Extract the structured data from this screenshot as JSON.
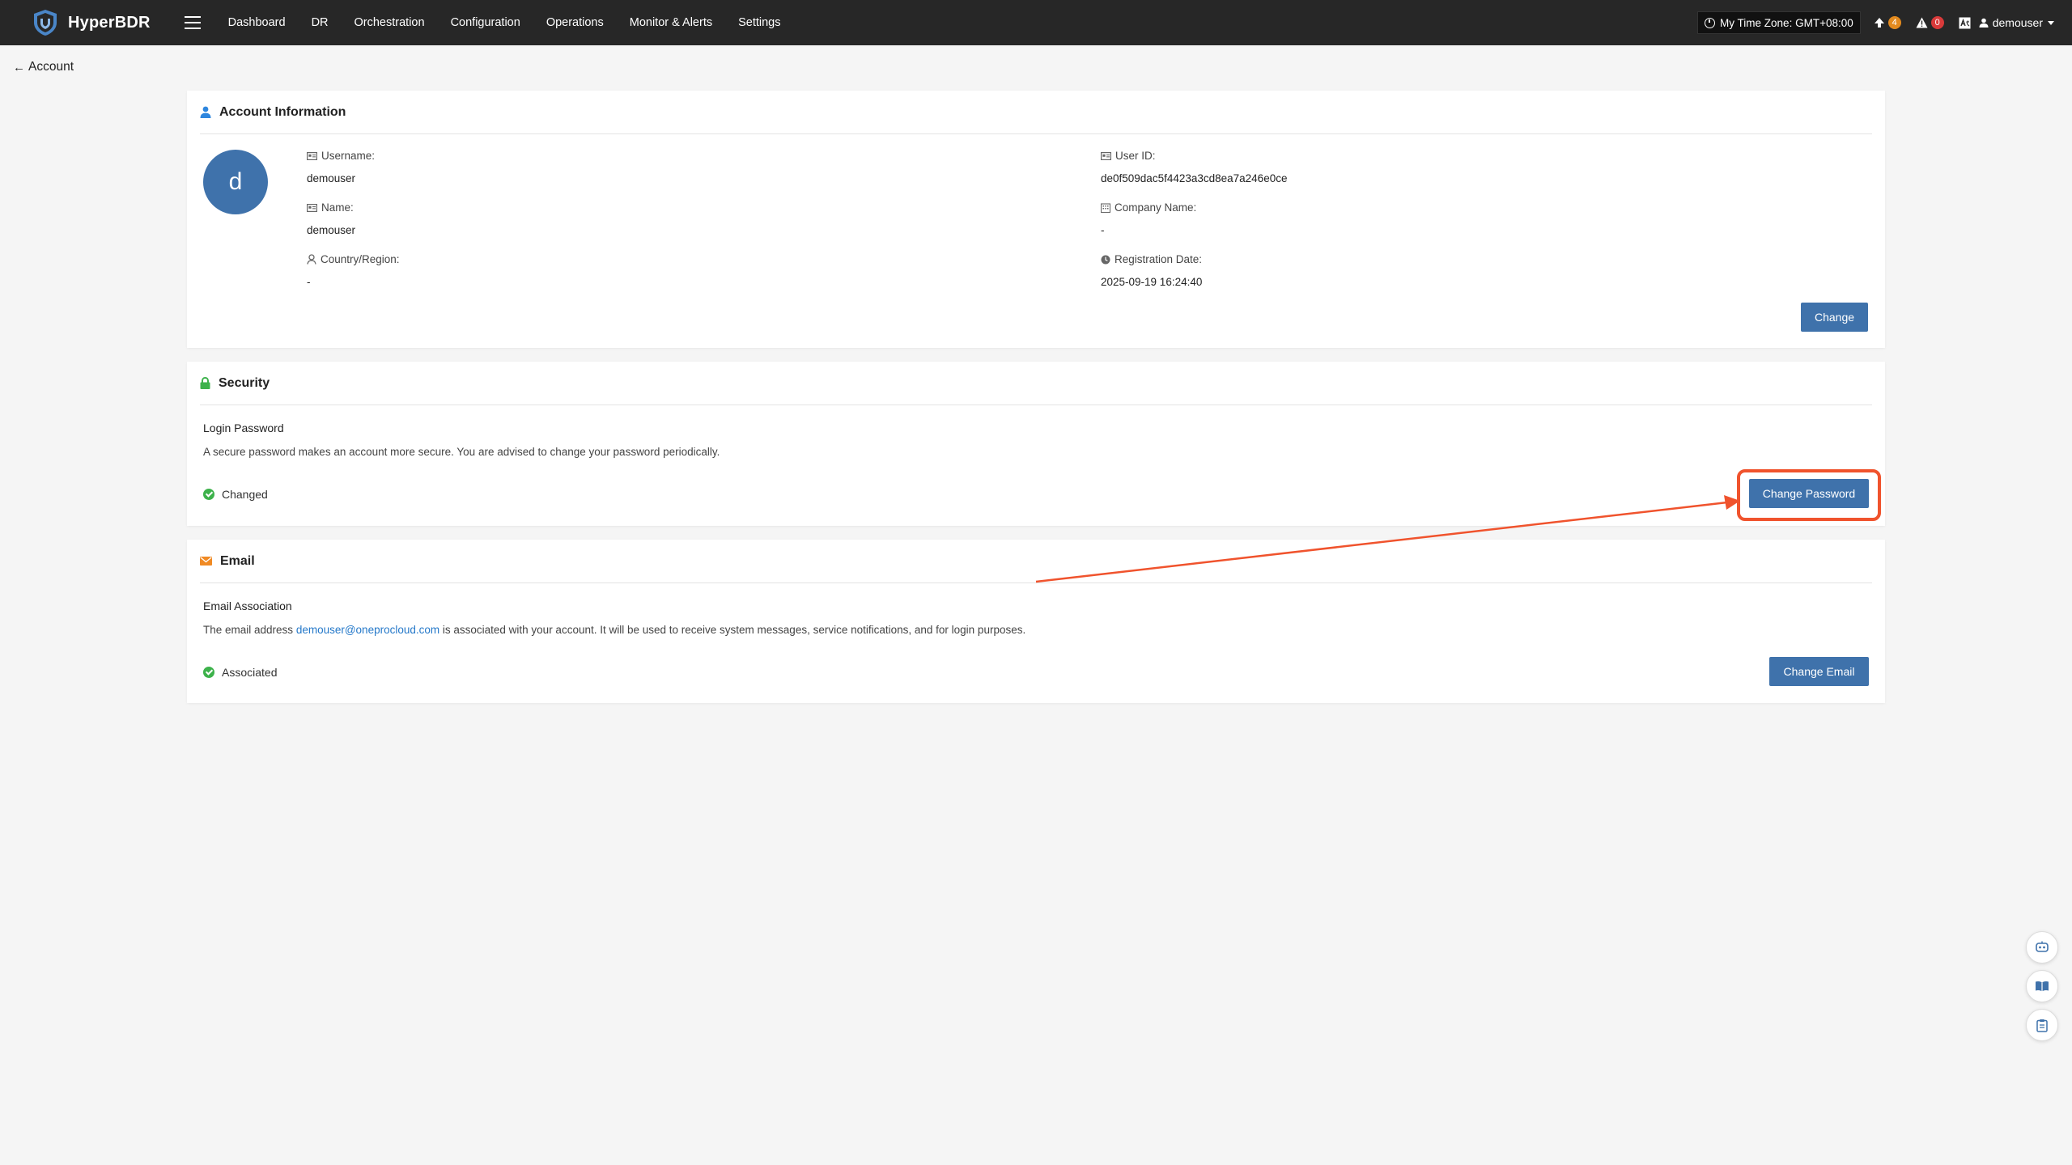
{
  "app": {
    "name": "HyperBDR"
  },
  "nav": [
    "Dashboard",
    "DR",
    "Orchestration",
    "Configuration",
    "Operations",
    "Monitor & Alerts",
    "Settings"
  ],
  "topbar": {
    "timezone": "My Time Zone: GMT+08:00",
    "upgrade_count": "4",
    "alert_count": "0",
    "username": "demouser"
  },
  "back_label": "Account",
  "account": {
    "title": "Account Information",
    "avatar_letter": "d",
    "fields": {
      "username_label": "Username:",
      "username": "demouser",
      "name_label": "Name:",
      "name": "demouser",
      "country_label": "Country/Region:",
      "country": "-",
      "userid_label": "User ID:",
      "userid": "de0f509dac5f4423a3cd8ea7a246e0ce",
      "company_label": "Company Name:",
      "company": "-",
      "regdate_label": "Registration Date:",
      "regdate": "2025-09-19 16:24:40"
    },
    "change_label": "Change"
  },
  "security": {
    "title": "Security",
    "subtitle": "Login Password",
    "desc": "A secure password makes an account more secure. You are advised to change your password periodically.",
    "status": "Changed",
    "button": "Change Password"
  },
  "email": {
    "title": "Email",
    "subtitle": "Email Association",
    "desc_prefix": "The email address ",
    "address": "demouser@oneprocloud.com",
    "desc_suffix": " is associated with your account. It will be used to receive system messages, service notifications, and for login purposes.",
    "status": "Associated",
    "button": "Change Email"
  },
  "colors": {
    "primary": "#3f72ab",
    "annotation": "#f0532d",
    "success": "#3db24b",
    "topbar": "#272727"
  }
}
